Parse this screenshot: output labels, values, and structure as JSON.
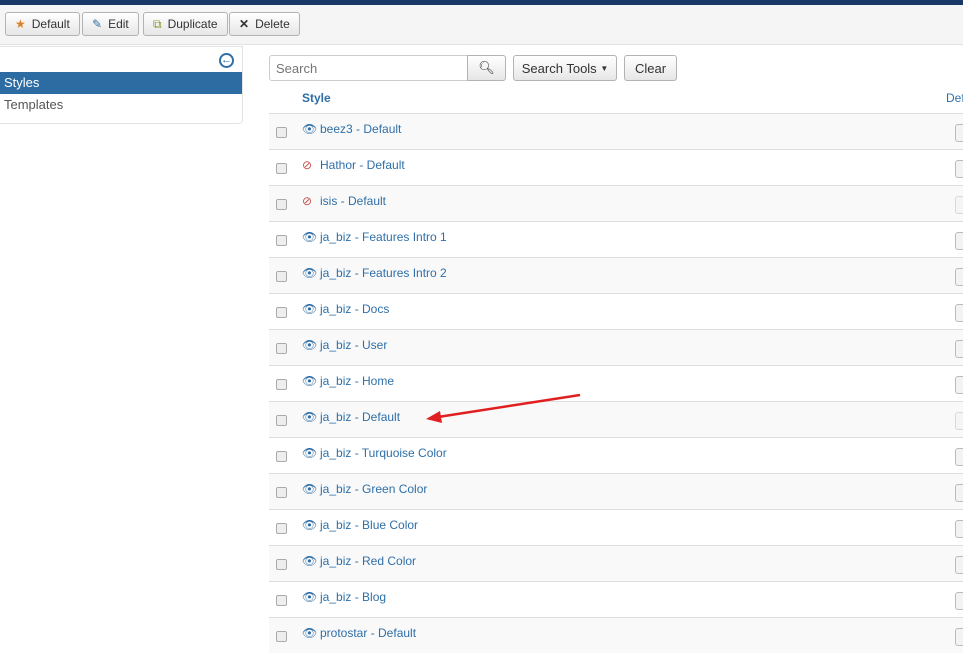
{
  "toolbar": {
    "default": "Default",
    "edit": "Edit",
    "duplicate": "Duplicate",
    "delete": "Delete"
  },
  "sidebar": {
    "items": [
      {
        "label": "Styles"
      },
      {
        "label": "Templates"
      }
    ]
  },
  "search": {
    "placeholder": "Search",
    "tools": "Search Tools",
    "clear": "Clear"
  },
  "table": {
    "col_style": "Style",
    "col_default": "Def",
    "rows": [
      {
        "name": "beez3 - Default",
        "visible": true
      },
      {
        "name": "Hathor - Default",
        "visible": false
      },
      {
        "name": "isis - Default",
        "visible": false
      },
      {
        "name": "ja_biz - Features Intro 1",
        "visible": true
      },
      {
        "name": "ja_biz - Features Intro 2",
        "visible": true
      },
      {
        "name": "ja_biz - Docs",
        "visible": true
      },
      {
        "name": "ja_biz - User",
        "visible": true
      },
      {
        "name": "ja_biz - Home",
        "visible": true
      },
      {
        "name": "ja_biz - Default",
        "visible": true
      },
      {
        "name": "ja_biz - Turquoise Color",
        "visible": true
      },
      {
        "name": "ja_biz - Green Color",
        "visible": true
      },
      {
        "name": "ja_biz - Blue Color",
        "visible": true
      },
      {
        "name": "ja_biz - Red Color",
        "visible": true
      },
      {
        "name": "ja_biz - Blog",
        "visible": true
      },
      {
        "name": "protostar - Default",
        "visible": true
      }
    ]
  },
  "colors": {
    "accent": "#2d6ca2",
    "link": "#2f6fa8",
    "annotation": "#e02020"
  }
}
